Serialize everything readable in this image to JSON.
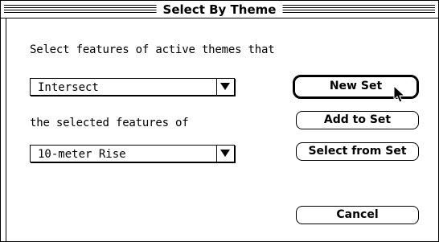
{
  "window": {
    "title": "Select By Theme"
  },
  "prompt": {
    "line1": "Select features of active themes that",
    "line2": "the selected features of"
  },
  "operation_popup": {
    "selected": "Intersect"
  },
  "theme_popup": {
    "selected": "10-meter Rise"
  },
  "buttons": {
    "new_set": "New Set",
    "add_to_set": "Add to Set",
    "select_from_set": "Select from Set",
    "cancel": "Cancel"
  },
  "icons": {
    "popup_arrow": "triangle-down-icon",
    "cursor": "arrow-pointer-icon"
  },
  "colors": {
    "background": "#ffffff",
    "foreground": "#000000"
  }
}
